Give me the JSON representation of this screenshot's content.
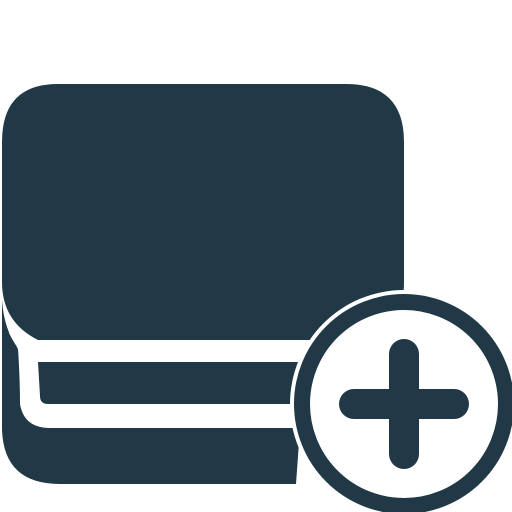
{
  "icon": {
    "name": "add-box-icon",
    "colors": {
      "primary": "#213847",
      "background": "#ffffff"
    },
    "badge": {
      "name": "plus-icon"
    }
  }
}
